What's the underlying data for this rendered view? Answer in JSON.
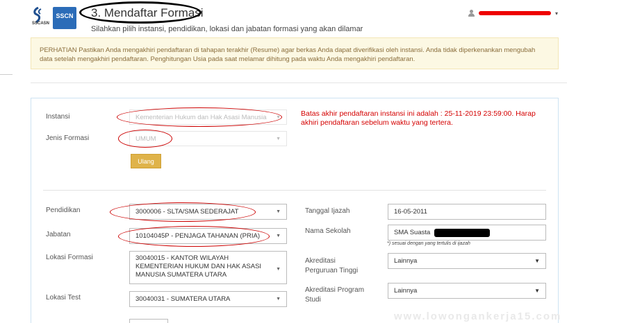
{
  "header": {
    "logo_sscn_text": "SSCN",
    "logo_caption": "SSCASN",
    "title": "3. Mendaftar Formasi",
    "subtitle": "Silahkan pilih instansi, pendidikan, lokasi dan jabatan formasi yang akan dilamar",
    "user_menu_icon": "user-icon",
    "user_menu_caret": "▾"
  },
  "notice": {
    "text": "PERHATIAN Pastikan Anda mengakhiri pendaftaran di tahapan terakhir (Resume) agar berkas Anda dapat diverifikasi oleh instansi. Anda tidak diperkenankan mengubah data setelah mengakhiri pendaftaran. Penghitungan Usia pada saat melamar dihitung pada waktu Anda mengakhiri pendaftaran."
  },
  "form_top": {
    "instansi_label": "Instansi",
    "instansi_value": "Kementerian Hukum dan Hak Asasi Manusia",
    "jenis_label": "Jenis Formasi",
    "jenis_value": "UMUM",
    "ulang_button": "Ulang",
    "deadline_note": "Batas akhir pendaftaran instansi ini adalah : 25-11-2019 23:59:00. Harap akhiri pendaftaran sebelum waktu yang tertera."
  },
  "form_left": {
    "pendidikan_label": "Pendidikan",
    "pendidikan_value": "3000006 - SLTA/SMA SEDERAJAT",
    "jabatan_label": "Jabatan",
    "jabatan_value": "10104045P - PENJAGA TAHANAN (PRIA)",
    "lokasi_formasi_label": "Lokasi Formasi",
    "lokasi_formasi_value": "30040015 - KANTOR WILAYAH KEMENTERIAN HUKUM DAN HAK ASASI MANUSIA SUMATERA UTARA",
    "lokasi_test_label": "Lokasi Test",
    "lokasi_test_value": "30040031 - SUMATERA UTARA"
  },
  "form_right": {
    "tanggal_label": "Tanggal Ijazah",
    "tanggal_value": "16-05-2011",
    "sekolah_label": "Nama Sekolah",
    "sekolah_value": "SMA Suasta",
    "sekolah_hint": "*) sesuai dengan yang tertulis di ijazah",
    "akreditasi_pt_label": "Akreditasi Perguruan Tinggi",
    "akreditasi_pt_value": "Lainnya",
    "akreditasi_prodi_label": "Akreditasi Program Studi",
    "akreditasi_prodi_value": "Lainnya"
  },
  "watermark": "www.lowongankerja15.com",
  "colors": {
    "notice_bg": "#fcf8e3",
    "notice_text": "#8a6d3b",
    "button_warning": "#dfb34a",
    "annotation_red": "#d40000",
    "brand_blue": "#2b6cb8"
  }
}
